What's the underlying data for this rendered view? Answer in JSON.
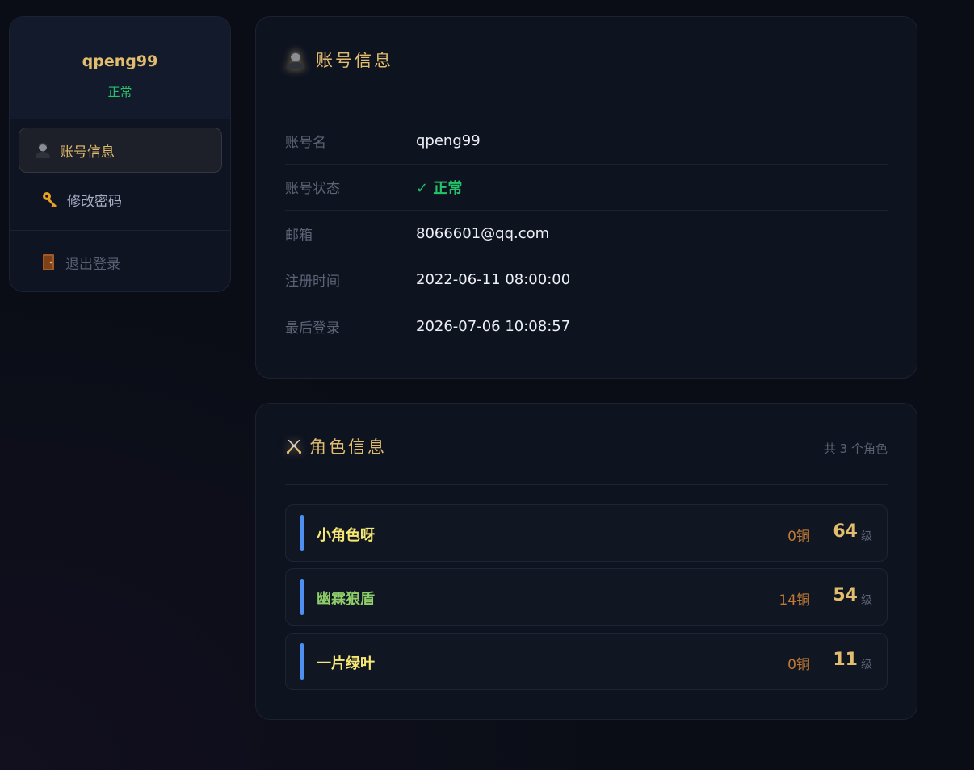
{
  "sidebar": {
    "username": "qpeng99",
    "status": "正常",
    "items": [
      {
        "label": "账号信息",
        "icon": "person-icon",
        "active": true
      },
      {
        "label": "修改密码",
        "icon": "key-icon",
        "active": false
      },
      {
        "label": "退出登录",
        "icon": "door-icon",
        "active": false
      }
    ]
  },
  "account": {
    "title": "账号信息",
    "icon": "person-icon",
    "rows": [
      {
        "label": "账号名",
        "value": "qpeng99"
      },
      {
        "label": "账号状态",
        "value": "✓ 正常"
      },
      {
        "label": "邮箱",
        "value": "8066601@qq.com"
      },
      {
        "label": "注册时间",
        "value": "2022-06-11 08:00:00"
      },
      {
        "label": "最后登录",
        "value": "2026-07-06 10:08:57"
      }
    ]
  },
  "roles": {
    "title": "角色信息",
    "icon": "crossed-swords-icon",
    "count_text": "共 3 个角色",
    "level_unit": "级",
    "items": [
      {
        "name": "小角色呀",
        "name_color": "#f6e873",
        "money": "0铜",
        "level": "64"
      },
      {
        "name": "幽霖狼盾",
        "name_color": "#8fcf6a",
        "money": "14铜",
        "level": "54"
      },
      {
        "name": "一片绿叶",
        "name_color": "#f6e873",
        "money": "0铜",
        "level": "11"
      }
    ]
  },
  "colors": {
    "accent": "#e2bd6e",
    "status_green": "#23c56b",
    "money": "#c27a34",
    "role_bar": "#4f8ff2"
  }
}
